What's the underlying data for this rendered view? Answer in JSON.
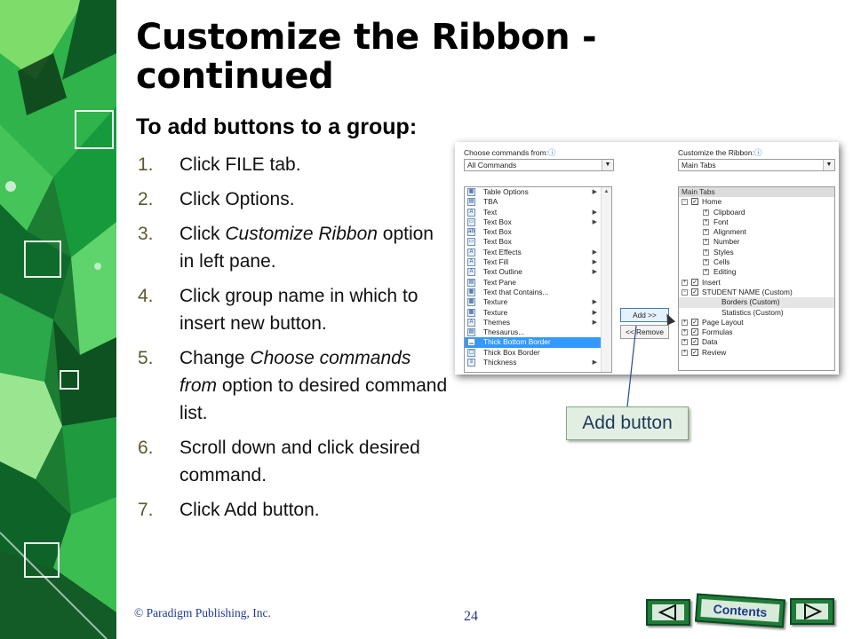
{
  "slide": {
    "title_line1": "Customize the Ribbon -",
    "title_line2": "continued",
    "subtitle": "To add buttons to a group:",
    "steps": [
      {
        "num": "1.",
        "text": "Click FILE tab."
      },
      {
        "num": "2.",
        "text": "Click Options."
      },
      {
        "num": "3.",
        "pre": "Click ",
        "em": "Customize Ribbon",
        "post": " option in left pane."
      },
      {
        "num": "4.",
        "text": "Click group name in which to insert new button."
      },
      {
        "num": "5.",
        "pre": "Change ",
        "em": "Choose commands from",
        "post": " option to desired command list."
      },
      {
        "num": "6.",
        "text": "Scroll down and click desired command."
      },
      {
        "num": "7.",
        "text": "Click Add button."
      }
    ]
  },
  "dialog": {
    "choose_label": "Choose commands from:",
    "choose_value": "All Commands",
    "customize_label": "Customize the Ribbon:",
    "customize_value": "Main Tabs",
    "info_icon": "ⓘ",
    "commands": [
      {
        "label": "Table Options",
        "icon": "table-icon",
        "glyph": "▦",
        "submenu": true
      },
      {
        "label": "TBA",
        "icon": "tba-icon",
        "glyph": "▤",
        "submenu": false
      },
      {
        "label": "Text",
        "icon": "text-icon",
        "glyph": "A",
        "submenu": true
      },
      {
        "label": "Text Box",
        "icon": "text-box-icon",
        "glyph": "▭",
        "submenu": true
      },
      {
        "label": "Text Box",
        "icon": "text-box-icon",
        "glyph": "ab",
        "submenu": false
      },
      {
        "label": "Text Box",
        "icon": "text-box-icon",
        "glyph": "▭",
        "submenu": false
      },
      {
        "label": "Text Effects",
        "icon": "text-effects-icon",
        "glyph": "A",
        "submenu": true
      },
      {
        "label": "Text Fill",
        "icon": "text-fill-icon",
        "glyph": "A",
        "submenu": true
      },
      {
        "label": "Text Outline",
        "icon": "text-outline-icon",
        "glyph": "A",
        "submenu": true
      },
      {
        "label": "Text Pane",
        "icon": "text-pane-icon",
        "glyph": "▤",
        "submenu": false
      },
      {
        "label": "Text that Contains...",
        "icon": "text-contains-icon",
        "glyph": "▦",
        "submenu": false
      },
      {
        "label": "Texture",
        "icon": "texture-icon",
        "glyph": "▩",
        "submenu": true
      },
      {
        "label": "Texture",
        "icon": "texture-icon",
        "glyph": "▩",
        "submenu": true
      },
      {
        "label": "Themes",
        "icon": "themes-icon",
        "glyph": "A",
        "submenu": true
      },
      {
        "label": "Thesaurus...",
        "icon": "thesaurus-icon",
        "glyph": "▤",
        "submenu": false
      },
      {
        "label": "Thick Bottom Border",
        "icon": "border-icon",
        "glyph": "▁",
        "submenu": false,
        "selected": true
      },
      {
        "label": "Thick Box Border",
        "icon": "border-icon",
        "glyph": "▢",
        "submenu": false
      },
      {
        "label": "Thickness",
        "icon": "thickness-icon",
        "glyph": "≡",
        "submenu": true
      }
    ],
    "tree_header": "Main Tabs",
    "tree": [
      {
        "label": "Home",
        "level": 0,
        "expander": "⊟",
        "checked": true
      },
      {
        "label": "Clipboard",
        "level": 1,
        "expander": "⊞",
        "checked": false
      },
      {
        "label": "Font",
        "level": 1,
        "expander": "⊞",
        "checked": false
      },
      {
        "label": "Alignment",
        "level": 1,
        "expander": "⊞",
        "checked": false
      },
      {
        "label": "Number",
        "level": 1,
        "expander": "⊞",
        "checked": false
      },
      {
        "label": "Styles",
        "level": 1,
        "expander": "⊞",
        "checked": false
      },
      {
        "label": "Cells",
        "level": 1,
        "expander": "⊞",
        "checked": false
      },
      {
        "label": "Editing",
        "level": 1,
        "expander": "⊞",
        "checked": false
      },
      {
        "label": "Insert",
        "level": 0,
        "expander": "⊞",
        "checked": true
      },
      {
        "label": "STUDENT NAME (Custom)",
        "level": 0,
        "expander": "⊟",
        "checked": true
      },
      {
        "label": "Borders (Custom)",
        "level": 2,
        "expander": "",
        "checked": false,
        "selected": true
      },
      {
        "label": "Statistics (Custom)",
        "level": 2,
        "expander": "",
        "checked": false
      },
      {
        "label": "Page Layout",
        "level": 0,
        "expander": "⊞",
        "checked": true
      },
      {
        "label": "Formulas",
        "level": 0,
        "expander": "⊞",
        "checked": true
      },
      {
        "label": "Data",
        "level": 0,
        "expander": "⊞",
        "checked": true
      },
      {
        "label": "Review",
        "level": 0,
        "expander": "⊞",
        "checked": true
      }
    ],
    "add_label": "Add >>",
    "remove_label": "<< Remove"
  },
  "callout": {
    "label": "Add button"
  },
  "footer": {
    "copyright": "© Paradigm Publishing, Inc.",
    "page_number": "24",
    "contents_label": "Contents",
    "prev_icon": "prev-arrow-icon",
    "next_icon": "next-arrow-icon"
  },
  "colors": {
    "banner_green": "#1f9a3f",
    "banner_light": "#7fd67f",
    "nav_green": "#1f7b3a",
    "selection_blue": "#3399ff",
    "footer_blue": "#1e3a8a"
  }
}
